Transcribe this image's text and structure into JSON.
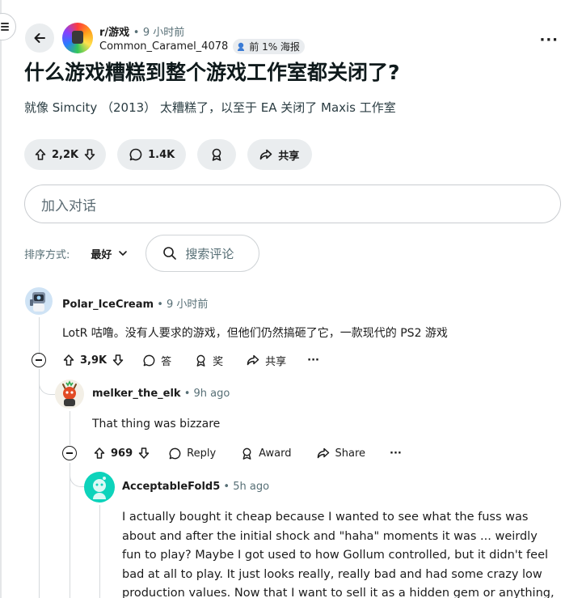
{
  "post": {
    "subreddit": "r/游戏",
    "separator": "•",
    "time": "9 小时前",
    "author": "Common_Caramel_4078",
    "flair": "前 1% 海报",
    "title": "什么游戏糟糕到整个游戏工作室都关闭了?",
    "body": "就像 Simcity （2013） 太糟糕了，以至于 EA 关闭了 Maxis 工作室",
    "upvotes": "2,2K",
    "comments": "1.4K",
    "share_label": "共享"
  },
  "join_placeholder": "加入对话",
  "sort": {
    "label": "排序方式:",
    "value": "最好",
    "search_placeholder": "搜索评论"
  },
  "comments": [
    {
      "user": "Polar_IceCream",
      "separator": "•",
      "time": "9 小时前",
      "text": "LotR 咕噜。没有人要求的游戏，但他们仍然搞砸了它，一款现代的 PS2 游戏",
      "votes": "3,9K",
      "reply_label": "答",
      "award_label": "奖",
      "share_label": "共享",
      "more": "···"
    },
    {
      "user": "melker_the_elk",
      "separator": "•",
      "time": "9h ago",
      "text": "That thing was bizzare",
      "votes": "969",
      "reply_label": "Reply",
      "award_label": "Award",
      "share_label": "Share",
      "more": "···"
    },
    {
      "user": "AcceptableFold5",
      "separator": "•",
      "time": "5h ago",
      "text": "I actually bought it cheap because I wanted to see what the fuss was about and after the initial shock and \"haha\" moments it was ... weirdly fun to play? Maybe I got used to how Gollum controlled, but it didn't feel bad at all to play. It just looks really, really bad and had some crazy low production values. Now that I want to sell it as a hidden gem or anything,"
    }
  ],
  "header": {
    "more": "···"
  },
  "icons": {
    "menu": "hamburger-icon",
    "back": "arrow-left-icon",
    "upvote": "arrow-up-icon",
    "downvote": "arrow-down-icon",
    "comment": "speech-bubble-icon",
    "award": "award-icon",
    "share": "share-arrow-icon",
    "search": "search-icon",
    "collapse": "minus-circle-icon"
  },
  "colors": {
    "pill_bg": "#eaedef",
    "meta_gray": "#576f76",
    "text": "#1c1c1c",
    "accent_teal": "#0dd3bb"
  }
}
